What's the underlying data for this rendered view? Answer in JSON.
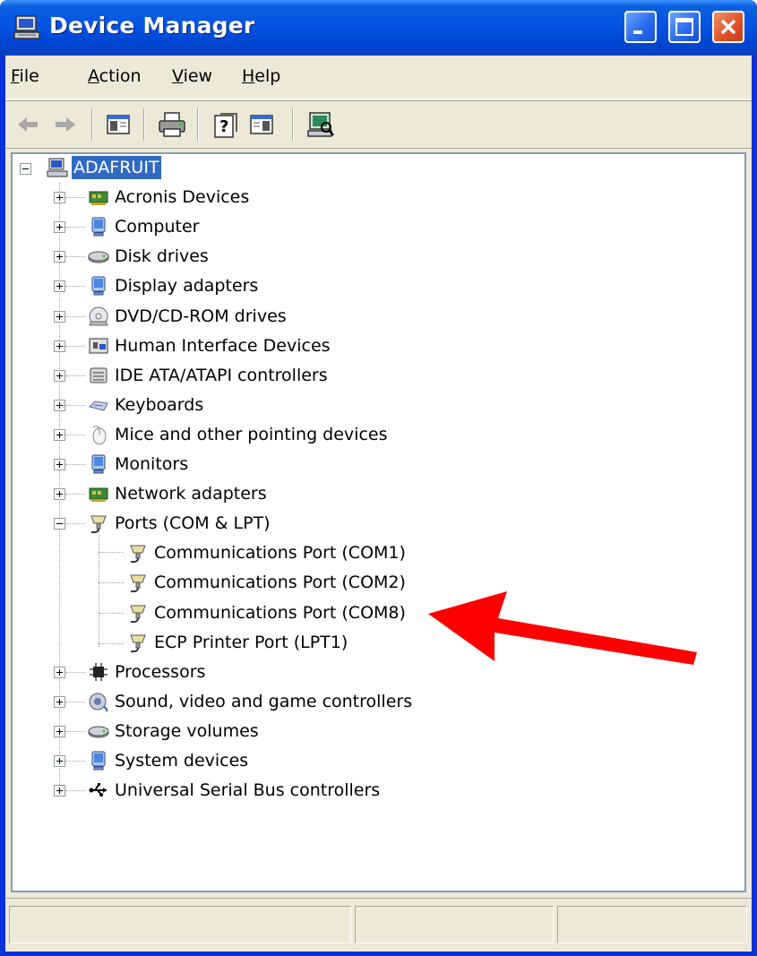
{
  "window": {
    "title": "Device Manager",
    "title_icon": "computer-icon",
    "controls": [
      "minimize-button",
      "maximize-button",
      "close-button"
    ]
  },
  "menu": {
    "items": [
      {
        "prefix": "",
        "accel": "F",
        "rest": "ile"
      },
      {
        "prefix": "",
        "accel": "A",
        "rest": "ction"
      },
      {
        "prefix": "",
        "accel": "V",
        "rest": "iew"
      },
      {
        "prefix": "",
        "accel": "H",
        "rest": "elp"
      }
    ]
  },
  "toolbar": {
    "buttons": [
      "back-icon",
      "forward-icon",
      "show-hide-console-tree-icon",
      "print-icon",
      "help-icon",
      "properties-icon",
      "scan-hardware-icon"
    ]
  },
  "tree": {
    "root": {
      "label": "ADAFRUIT",
      "icon": "computer-icon",
      "expanded": true,
      "selected": true
    },
    "categories": [
      {
        "label": "Acronis Devices",
        "icon": "card-icon",
        "expanded": false
      },
      {
        "label": "Computer",
        "icon": "monitor-icon",
        "expanded": false
      },
      {
        "label": "Disk drives",
        "icon": "disk-icon",
        "expanded": false
      },
      {
        "label": "Display adapters",
        "icon": "monitor-icon",
        "expanded": false
      },
      {
        "label": "DVD/CD-ROM drives",
        "icon": "cdrom-icon",
        "expanded": false
      },
      {
        "label": "Human Interface Devices",
        "icon": "hid-icon",
        "expanded": false
      },
      {
        "label": "IDE ATA/ATAPI controllers",
        "icon": "ide-icon",
        "expanded": false
      },
      {
        "label": "Keyboards",
        "icon": "keyboard-icon",
        "expanded": false
      },
      {
        "label": "Mice and other pointing devices",
        "icon": "mouse-icon",
        "expanded": false
      },
      {
        "label": "Monitors",
        "icon": "monitor-icon",
        "expanded": false
      },
      {
        "label": "Network adapters",
        "icon": "card-icon",
        "expanded": false
      },
      {
        "label": "Ports (COM & LPT)",
        "icon": "port-icon",
        "expanded": true,
        "children": [
          {
            "label": "Communications Port (COM1)",
            "icon": "port-icon"
          },
          {
            "label": "Communications Port (COM2)",
            "icon": "port-icon"
          },
          {
            "label": "Communications Port (COM8)",
            "icon": "port-icon"
          },
          {
            "label": "ECP Printer Port (LPT1)",
            "icon": "port-icon"
          }
        ]
      },
      {
        "label": "Processors",
        "icon": "chip-icon",
        "expanded": false
      },
      {
        "label": "Sound, video and game controllers",
        "icon": "sound-icon",
        "expanded": false
      },
      {
        "label": "Storage volumes",
        "icon": "disk-icon",
        "expanded": false
      },
      {
        "label": "System devices",
        "icon": "monitor-icon",
        "expanded": false
      },
      {
        "label": "Universal Serial Bus controllers",
        "icon": "usb-icon",
        "expanded": false
      }
    ]
  },
  "annotation": {
    "type": "red-arrow",
    "points_to": "Communications Port (COM8)",
    "color": "#ff0000"
  },
  "colors": {
    "titlebar": "#0054e3",
    "selection": "#316ac5",
    "face": "#ece9d8",
    "close": "#e0542a"
  }
}
